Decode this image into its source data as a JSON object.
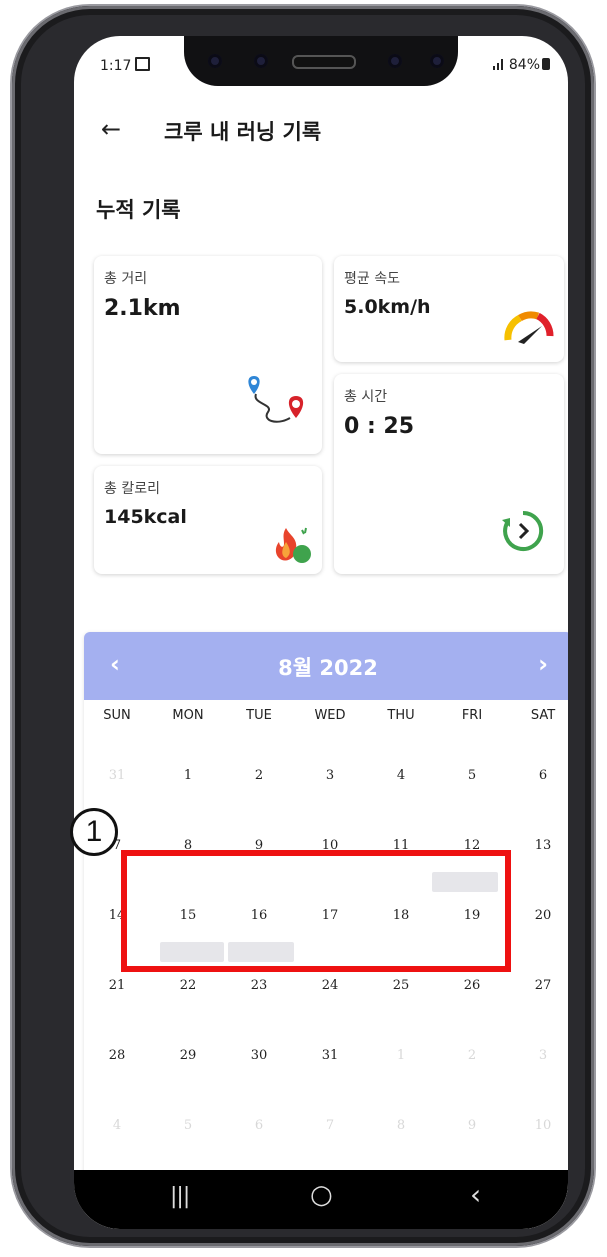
{
  "status_bar": {
    "time": "1:17",
    "battery": "84%"
  },
  "header": {
    "title": "크루 내 러닝 기록",
    "back_icon": "←"
  },
  "section": {
    "title": "누적 기록"
  },
  "cards": {
    "distance": {
      "label": "총 거리",
      "value": "2.1km",
      "icon": "route-pin-icon"
    },
    "speed": {
      "label": "평균 속도",
      "value": "5.0km/h",
      "icon": "speedometer-icon"
    },
    "time": {
      "label": "총 시간",
      "value": "0 : 25",
      "icon": "timer-refresh-icon"
    },
    "calories": {
      "label": "총 칼로리",
      "value": "145kcal",
      "icon": "flame-icon"
    }
  },
  "calendar": {
    "title": "8월 2022",
    "prev": "‹",
    "next": "›",
    "weekdays": [
      "SUN",
      "MON",
      "TUE",
      "WED",
      "THU",
      "FRI",
      "SAT"
    ],
    "weeks": [
      [
        "31",
        "1",
        "2",
        "3",
        "4",
        "5",
        "6"
      ],
      [
        "7",
        "8",
        "9",
        "10",
        "11",
        "12",
        "13"
      ],
      [
        "14",
        "15",
        "16",
        "17",
        "18",
        "19",
        "20"
      ],
      [
        "21",
        "22",
        "23",
        "24",
        "25",
        "26",
        "27"
      ],
      [
        "28",
        "29",
        "30",
        "31",
        "1",
        "2",
        "3"
      ],
      [
        "4",
        "5",
        "6",
        "7",
        "8",
        "9",
        "10"
      ]
    ]
  },
  "annotation": {
    "number": "1"
  },
  "nav": {
    "recent": "|||",
    "home": "○",
    "back": "‹"
  },
  "colors": {
    "calendar_header": "#a4b0f0",
    "annotation": "#ee1111"
  }
}
